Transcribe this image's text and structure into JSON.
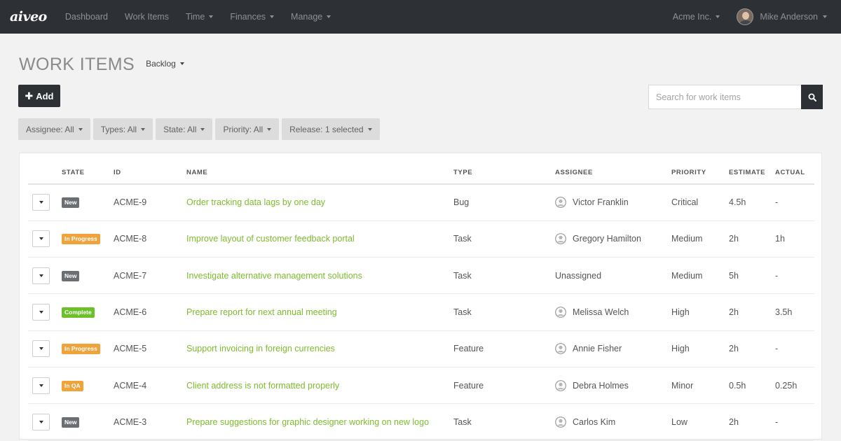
{
  "nav": {
    "logo": "aiveo",
    "links": [
      "Dashboard",
      "Work Items",
      "Time",
      "Finances",
      "Manage"
    ],
    "org": "Acme Inc.",
    "user": "Mike Anderson"
  },
  "header": {
    "title": "WORK ITEMS",
    "view": "Backlog",
    "add_label": "Add",
    "search_placeholder": "Search for work items"
  },
  "filters": [
    "Assignee: All",
    "Types: All",
    "State: All",
    "Priority: All",
    "Release: 1 selected"
  ],
  "table": {
    "columns": [
      "STATE",
      "ID",
      "NAME",
      "TYPE",
      "ASSIGNEE",
      "PRIORITY",
      "ESTIMATE",
      "ACTUAL"
    ],
    "rows": [
      {
        "state": "New",
        "id": "ACME-9",
        "name": "Order tracking data lags by one day",
        "type": "Bug",
        "assignee": "Victor Franklin",
        "priority": "Critical",
        "estimate": "4.5h",
        "actual": "-"
      },
      {
        "state": "In Progress",
        "id": "ACME-8",
        "name": "Improve layout of customer feedback portal",
        "type": "Task",
        "assignee": "Gregory Hamilton",
        "priority": "Medium",
        "estimate": "2h",
        "actual": "1h"
      },
      {
        "state": "New",
        "id": "ACME-7",
        "name": "Investigate alternative management solutions",
        "type": "Task",
        "assignee": "Unassigned",
        "priority": "Medium",
        "estimate": "5h",
        "actual": "-"
      },
      {
        "state": "Complete",
        "id": "ACME-6",
        "name": "Prepare report for next annual meeting",
        "type": "Task",
        "assignee": "Melissa Welch",
        "priority": "High",
        "estimate": "2h",
        "actual": "3.5h"
      },
      {
        "state": "In Progress",
        "id": "ACME-5",
        "name": "Support invoicing in foreign currencies",
        "type": "Feature",
        "assignee": "Annie Fisher",
        "priority": "High",
        "estimate": "2h",
        "actual": "-"
      },
      {
        "state": "In QA",
        "id": "ACME-4",
        "name": "Client address is not formatted properly",
        "type": "Feature",
        "assignee": "Debra Holmes",
        "priority": "Minor",
        "estimate": "0.5h",
        "actual": "0.25h"
      },
      {
        "state": "New",
        "id": "ACME-3",
        "name": "Prepare suggestions for graphic designer working on new logo",
        "type": "Task",
        "assignee": "Carlos Kim",
        "priority": "Low",
        "estimate": "2h",
        "actual": "-"
      }
    ]
  },
  "state_colors": {
    "New": "#6b6e72",
    "In Progress": "#f0a23b",
    "Complete": "#6cc12a",
    "In QA": "#f0a23b"
  },
  "colors": {
    "nav_bg": "#2d3034",
    "link_green": "#7dbb2d"
  }
}
